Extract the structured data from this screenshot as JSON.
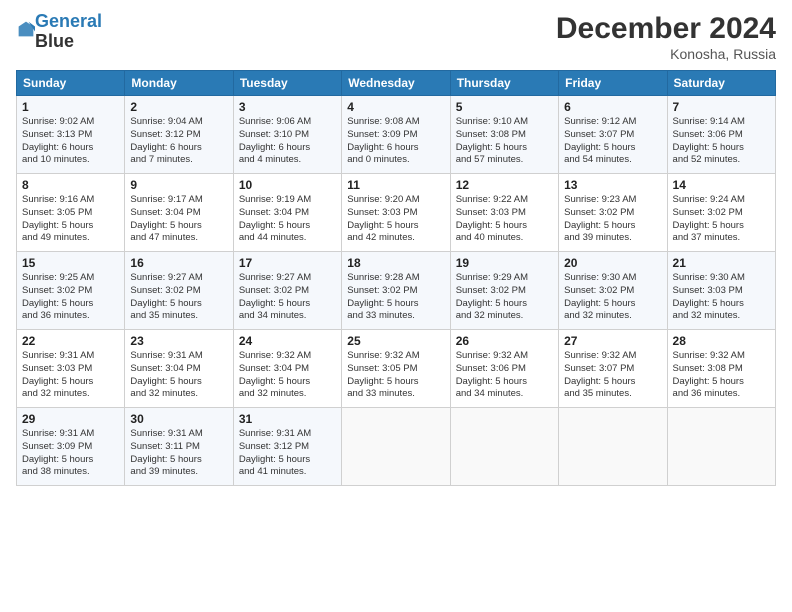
{
  "logo": {
    "line1": "General",
    "line2": "Blue"
  },
  "header": {
    "month": "December 2024",
    "location": "Konosha, Russia"
  },
  "weekdays": [
    "Sunday",
    "Monday",
    "Tuesday",
    "Wednesday",
    "Thursday",
    "Friday",
    "Saturday"
  ],
  "weeks": [
    [
      {
        "day": "1",
        "info": "Sunrise: 9:02 AM\nSunset: 3:13 PM\nDaylight: 6 hours\nand 10 minutes."
      },
      {
        "day": "2",
        "info": "Sunrise: 9:04 AM\nSunset: 3:12 PM\nDaylight: 6 hours\nand 7 minutes."
      },
      {
        "day": "3",
        "info": "Sunrise: 9:06 AM\nSunset: 3:10 PM\nDaylight: 6 hours\nand 4 minutes."
      },
      {
        "day": "4",
        "info": "Sunrise: 9:08 AM\nSunset: 3:09 PM\nDaylight: 6 hours\nand 0 minutes."
      },
      {
        "day": "5",
        "info": "Sunrise: 9:10 AM\nSunset: 3:08 PM\nDaylight: 5 hours\nand 57 minutes."
      },
      {
        "day": "6",
        "info": "Sunrise: 9:12 AM\nSunset: 3:07 PM\nDaylight: 5 hours\nand 54 minutes."
      },
      {
        "day": "7",
        "info": "Sunrise: 9:14 AM\nSunset: 3:06 PM\nDaylight: 5 hours\nand 52 minutes."
      }
    ],
    [
      {
        "day": "8",
        "info": "Sunrise: 9:16 AM\nSunset: 3:05 PM\nDaylight: 5 hours\nand 49 minutes."
      },
      {
        "day": "9",
        "info": "Sunrise: 9:17 AM\nSunset: 3:04 PM\nDaylight: 5 hours\nand 47 minutes."
      },
      {
        "day": "10",
        "info": "Sunrise: 9:19 AM\nSunset: 3:04 PM\nDaylight: 5 hours\nand 44 minutes."
      },
      {
        "day": "11",
        "info": "Sunrise: 9:20 AM\nSunset: 3:03 PM\nDaylight: 5 hours\nand 42 minutes."
      },
      {
        "day": "12",
        "info": "Sunrise: 9:22 AM\nSunset: 3:03 PM\nDaylight: 5 hours\nand 40 minutes."
      },
      {
        "day": "13",
        "info": "Sunrise: 9:23 AM\nSunset: 3:02 PM\nDaylight: 5 hours\nand 39 minutes."
      },
      {
        "day": "14",
        "info": "Sunrise: 9:24 AM\nSunset: 3:02 PM\nDaylight: 5 hours\nand 37 minutes."
      }
    ],
    [
      {
        "day": "15",
        "info": "Sunrise: 9:25 AM\nSunset: 3:02 PM\nDaylight: 5 hours\nand 36 minutes."
      },
      {
        "day": "16",
        "info": "Sunrise: 9:27 AM\nSunset: 3:02 PM\nDaylight: 5 hours\nand 35 minutes."
      },
      {
        "day": "17",
        "info": "Sunrise: 9:27 AM\nSunset: 3:02 PM\nDaylight: 5 hours\nand 34 minutes."
      },
      {
        "day": "18",
        "info": "Sunrise: 9:28 AM\nSunset: 3:02 PM\nDaylight: 5 hours\nand 33 minutes."
      },
      {
        "day": "19",
        "info": "Sunrise: 9:29 AM\nSunset: 3:02 PM\nDaylight: 5 hours\nand 32 minutes."
      },
      {
        "day": "20",
        "info": "Sunrise: 9:30 AM\nSunset: 3:02 PM\nDaylight: 5 hours\nand 32 minutes."
      },
      {
        "day": "21",
        "info": "Sunrise: 9:30 AM\nSunset: 3:03 PM\nDaylight: 5 hours\nand 32 minutes."
      }
    ],
    [
      {
        "day": "22",
        "info": "Sunrise: 9:31 AM\nSunset: 3:03 PM\nDaylight: 5 hours\nand 32 minutes."
      },
      {
        "day": "23",
        "info": "Sunrise: 9:31 AM\nSunset: 3:04 PM\nDaylight: 5 hours\nand 32 minutes."
      },
      {
        "day": "24",
        "info": "Sunrise: 9:32 AM\nSunset: 3:04 PM\nDaylight: 5 hours\nand 32 minutes."
      },
      {
        "day": "25",
        "info": "Sunrise: 9:32 AM\nSunset: 3:05 PM\nDaylight: 5 hours\nand 33 minutes."
      },
      {
        "day": "26",
        "info": "Sunrise: 9:32 AM\nSunset: 3:06 PM\nDaylight: 5 hours\nand 34 minutes."
      },
      {
        "day": "27",
        "info": "Sunrise: 9:32 AM\nSunset: 3:07 PM\nDaylight: 5 hours\nand 35 minutes."
      },
      {
        "day": "28",
        "info": "Sunrise: 9:32 AM\nSunset: 3:08 PM\nDaylight: 5 hours\nand 36 minutes."
      }
    ],
    [
      {
        "day": "29",
        "info": "Sunrise: 9:31 AM\nSunset: 3:09 PM\nDaylight: 5 hours\nand 38 minutes."
      },
      {
        "day": "30",
        "info": "Sunrise: 9:31 AM\nSunset: 3:11 PM\nDaylight: 5 hours\nand 39 minutes."
      },
      {
        "day": "31",
        "info": "Sunrise: 9:31 AM\nSunset: 3:12 PM\nDaylight: 5 hours\nand 41 minutes."
      },
      {
        "day": "",
        "info": ""
      },
      {
        "day": "",
        "info": ""
      },
      {
        "day": "",
        "info": ""
      },
      {
        "day": "",
        "info": ""
      }
    ]
  ]
}
